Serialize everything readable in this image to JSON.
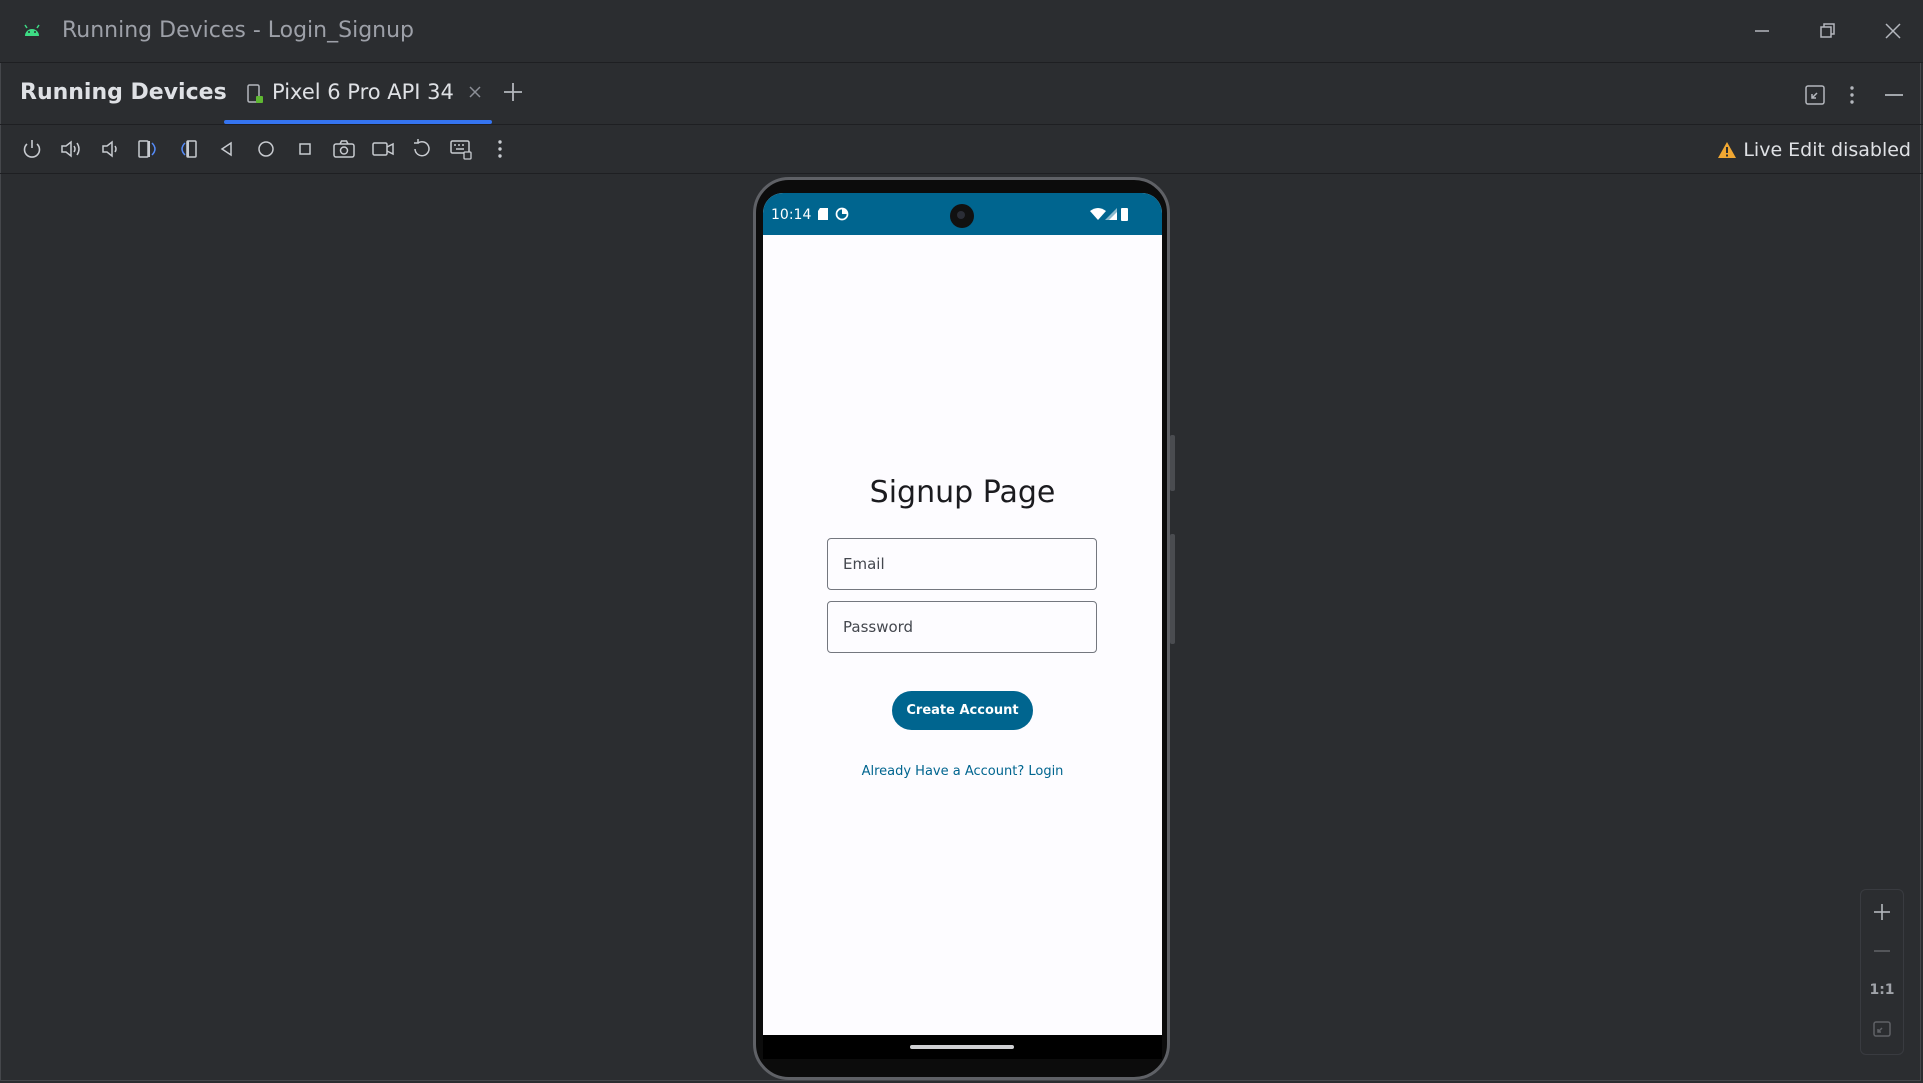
{
  "window": {
    "title": "Running Devices - Login_Signup"
  },
  "tool_window": {
    "title": "Running Devices",
    "tab_label": "Pixel 6 Pro API 34"
  },
  "toolbar": {
    "live_edit_status": "Live Edit disabled"
  },
  "device": {
    "status_time": "10:14",
    "page_title": "Signup Page",
    "email_placeholder": "Email",
    "password_placeholder": "Password",
    "create_button_label": "Create Account",
    "login_link_label": "Already Have a Account? Login"
  },
  "zoom_controls": {
    "actual_size_label": "1:1"
  },
  "colors": {
    "accent": "#00658f",
    "ide_background": "#2b2d30",
    "tab_indicator": "#3574f0",
    "warning": "#f0a732"
  }
}
